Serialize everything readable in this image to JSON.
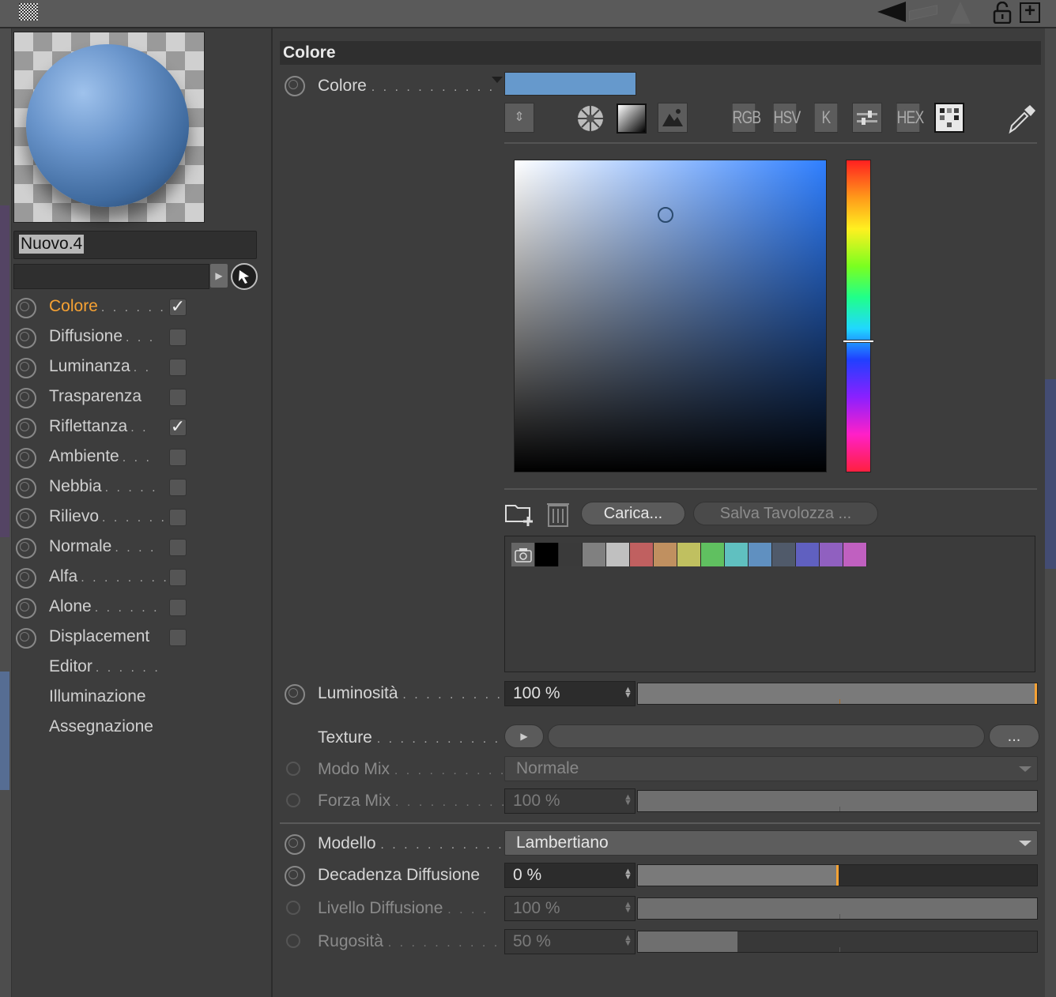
{
  "material": {
    "name": "Nuovo.4"
  },
  "channels": [
    {
      "label": "Colore",
      "dots": ". . . . . .",
      "checked": true,
      "active": true,
      "has_radio": true
    },
    {
      "label": "Diffusione",
      "dots": ". . .",
      "checked": false,
      "active": false,
      "has_radio": true
    },
    {
      "label": "Luminanza",
      "dots": ". .",
      "checked": false,
      "active": false,
      "has_radio": true
    },
    {
      "label": "Trasparenza",
      "dots": "",
      "checked": false,
      "active": false,
      "has_radio": true
    },
    {
      "label": "Riflettanza",
      "dots": ". .",
      "checked": true,
      "active": false,
      "has_radio": true
    },
    {
      "label": "Ambiente",
      "dots": ". . .",
      "checked": false,
      "active": false,
      "has_radio": true
    },
    {
      "label": "Nebbia",
      "dots": ". . . . .",
      "checked": false,
      "active": false,
      "has_radio": true
    },
    {
      "label": "Rilievo",
      "dots": ". . . . . .",
      "checked": false,
      "active": false,
      "has_radio": true
    },
    {
      "label": "Normale",
      "dots": ". . . .",
      "checked": false,
      "active": false,
      "has_radio": true
    },
    {
      "label": "Alfa",
      "dots": ". . . . . . . .",
      "checked": false,
      "active": false,
      "has_radio": true
    },
    {
      "label": "Alone",
      "dots": ". . . . . .",
      "checked": false,
      "active": false,
      "has_radio": true
    },
    {
      "label": "Displacement",
      "dots": "",
      "checked": false,
      "active": false,
      "has_radio": true
    },
    {
      "label": "Editor",
      "dots": ". . . . . .",
      "checked": null,
      "active": false,
      "has_radio": false
    },
    {
      "label": "Illuminazione",
      "dots": "",
      "checked": null,
      "active": false,
      "has_radio": false
    },
    {
      "label": "Assegnazione",
      "dots": "",
      "checked": null,
      "active": false,
      "has_radio": false
    }
  ],
  "section": {
    "title": "Colore"
  },
  "color": {
    "label": "Colore",
    "dots": ". . . . . . . . . . .",
    "swatch_color": "#6699cc",
    "mode_buttons": [
      "RGB",
      "HSV",
      "K",
      "HEX"
    ],
    "hue_level": 0.58,
    "saturation": 0.48,
    "value": 0.82
  },
  "palette": {
    "load_button": "Carica...",
    "save_button": "Salva Tavolozza ...",
    "colors": [
      "#000000",
      "#3a3a3a",
      "#808080",
      "#c0c0c0",
      "#c06060",
      "#c09060",
      "#c0c060",
      "#60c060",
      "#60c0c0",
      "#6090c0",
      "#505a6a",
      "#6060c0",
      "#9060c0",
      "#c060c0"
    ]
  },
  "properties": {
    "luminosita": {
      "label": "Luminosità",
      "dots": ". . . . . . . . .",
      "value": "100 %",
      "level": 1.0
    },
    "texture": {
      "label": "Texture",
      "dots": ". . . . . . . . . . . .",
      "more_button": "..."
    },
    "modo_mix": {
      "label": "Modo Mix",
      "dots": ". . . . . . . . . .",
      "value": "Normale"
    },
    "forza_mix": {
      "label": "Forza Mix",
      "dots": ". . . . . . . . . .",
      "value": "100 %",
      "level": 1.0
    },
    "modello": {
      "label": "Modello",
      "dots": ". . . . . . . . . . .",
      "value": "Lambertiano"
    },
    "decadenza": {
      "label": "Decadenza Diffusione",
      "value": "0 %",
      "level": 0.5
    },
    "livello": {
      "label": "Livello Diffusione",
      "dots": ". . . .",
      "value": "100 %",
      "level": 1.0
    },
    "rugosita": {
      "label": "Rugosità",
      "dots": ". . . . . . . . . . .",
      "value": "50 %",
      "level": 0.25
    }
  }
}
